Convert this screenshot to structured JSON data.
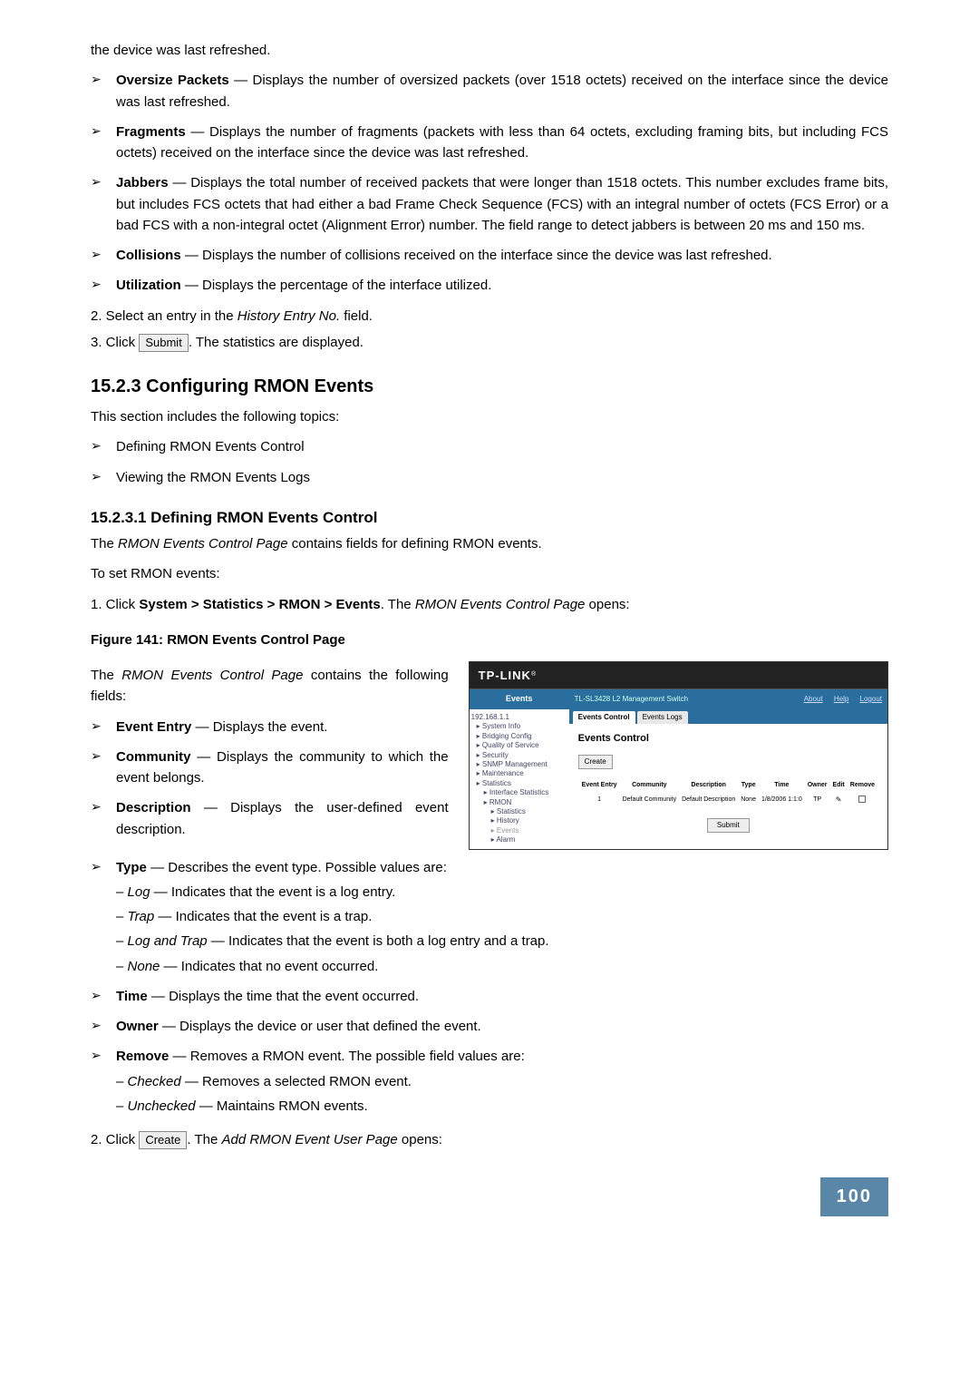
{
  "intro_tail": "the device was last refreshed.",
  "top_bullets": [
    {
      "term": "Oversize Packets",
      "text": " — Displays the number of oversized packets (over 1518 octets) received on the interface since the device was last refreshed."
    },
    {
      "term": "Fragments",
      "text": " — Displays the number of fragments (packets with less than 64 octets, excluding framing bits, but including FCS octets) received on the interface since the device was last refreshed."
    },
    {
      "term": "Jabbers",
      "text": " — Displays the total number of received packets that were longer than 1518 octets. This number excludes frame bits, but includes FCS octets that had either a bad Frame Check Sequence (FCS) with an integral number of octets (FCS Error) or a bad FCS with a non-integral octet (Alignment Error) number. The field range to detect jabbers is between 20 ms and 150 ms."
    },
    {
      "term": "Collisions",
      "text": " — Displays the number of collisions received on the interface since the device was last refreshed."
    },
    {
      "term": "Utilization",
      "text": " — Displays the percentage of the interface utilized."
    }
  ],
  "steps_a": {
    "s2_pre": "2.   Select an entry in the ",
    "s2_mid": "History Entry No.",
    "s2_post": " field.",
    "s3_pre": "3.   Click ",
    "s3_btn": "Submit",
    "s3_post": ". The statistics are displayed."
  },
  "section_heading": "15.2.3   Configuring RMON Events",
  "section_intro": "This section includes the following topics:",
  "section_topics": [
    "Defining RMON Events Control",
    "Viewing the RMON Events Logs"
  ],
  "subsec_heading": "15.2.3.1   Defining RMON Events Control",
  "subsec_intro_pre": "The ",
  "subsec_intro_mid": "RMON Events Control Page",
  "subsec_intro_post": " contains fields for defining RMON events.",
  "set_intro": "To set RMON events:",
  "step1_pre": "1.   Click ",
  "step1_bold": "System > Statistics > RMON > Events",
  "step1_mid": ". The ",
  "step1_italic": "RMON Events Control Page",
  "step1_post": " opens:",
  "figure_label": "Figure 141: RMON Events Control Page",
  "fields_intro_pre": "The ",
  "fields_intro_mid": "RMON Events Control Page",
  "fields_intro_post": " contains the following fields:",
  "left_bullets": [
    {
      "term": "Event Entry",
      "text": " — Displays the event."
    },
    {
      "term": "Community",
      "text": " — Displays the community to which the event belongs."
    },
    {
      "term": "Description",
      "text": " — Displays the user-defined event description."
    }
  ],
  "type_bullet": {
    "term": "Type",
    "text": " — Describes the event type. Possible values are:"
  },
  "type_items": [
    {
      "italic": "Log",
      "text": " — Indicates that the event is a log entry."
    },
    {
      "italic": "Trap",
      "text": " — Indicates that the event is a trap."
    },
    {
      "italic": "Log and Trap",
      "text": " — Indicates that the event is both a log entry and a trap."
    },
    {
      "italic": "None",
      "text": " — Indicates that no event occurred."
    }
  ],
  "tail_bullets": [
    {
      "term": "Time",
      "text": " — Displays the time that the event occurred."
    },
    {
      "term": "Owner",
      "text": " — Displays the device or user that defined the event."
    },
    {
      "term": "Remove",
      "text": " — Removes a RMON event. The possible field values are:"
    }
  ],
  "remove_items": [
    {
      "italic": "Checked",
      "text": " — Removes a selected RMON event."
    },
    {
      "italic": "Unchecked",
      "text": " — Maintains RMON events."
    }
  ],
  "step2_pre": "2.   Click ",
  "step2_btn": "Create",
  "step2_mid": ". The ",
  "step2_italic": "Add RMON Event User Page",
  "step2_post": " opens:",
  "screenshot": {
    "logo": "TP-LINK",
    "sidebar_title": "Events",
    "product": "TL-SL3428 L2 Management Switch",
    "links": {
      "about": "About",
      "help": "Help",
      "logout": "Logout"
    },
    "tabs": {
      "active": "Events Control",
      "other": "Events Logs"
    },
    "panel_title": "Events Control",
    "create_btn": "Create",
    "headers": [
      "Event Entry",
      "Community",
      "Description",
      "Type",
      "Time",
      "Owner",
      "Edit",
      "Remove"
    ],
    "row": {
      "entry": "1",
      "community": "Default Community",
      "description": "Default Description",
      "type": "None",
      "time": "1/8/2006 1:1:0",
      "owner": "TP"
    },
    "submit": "Submit",
    "tree": [
      "192.168.1.1",
      "System Info",
      "Bridging Config",
      "Quality of Service",
      "Security",
      "SNMP Management",
      "Maintenance",
      "Statistics",
      "Interface Statistics",
      "RMON",
      "Statistics",
      "History",
      "Events",
      "Alarm"
    ]
  },
  "page_number": "100"
}
